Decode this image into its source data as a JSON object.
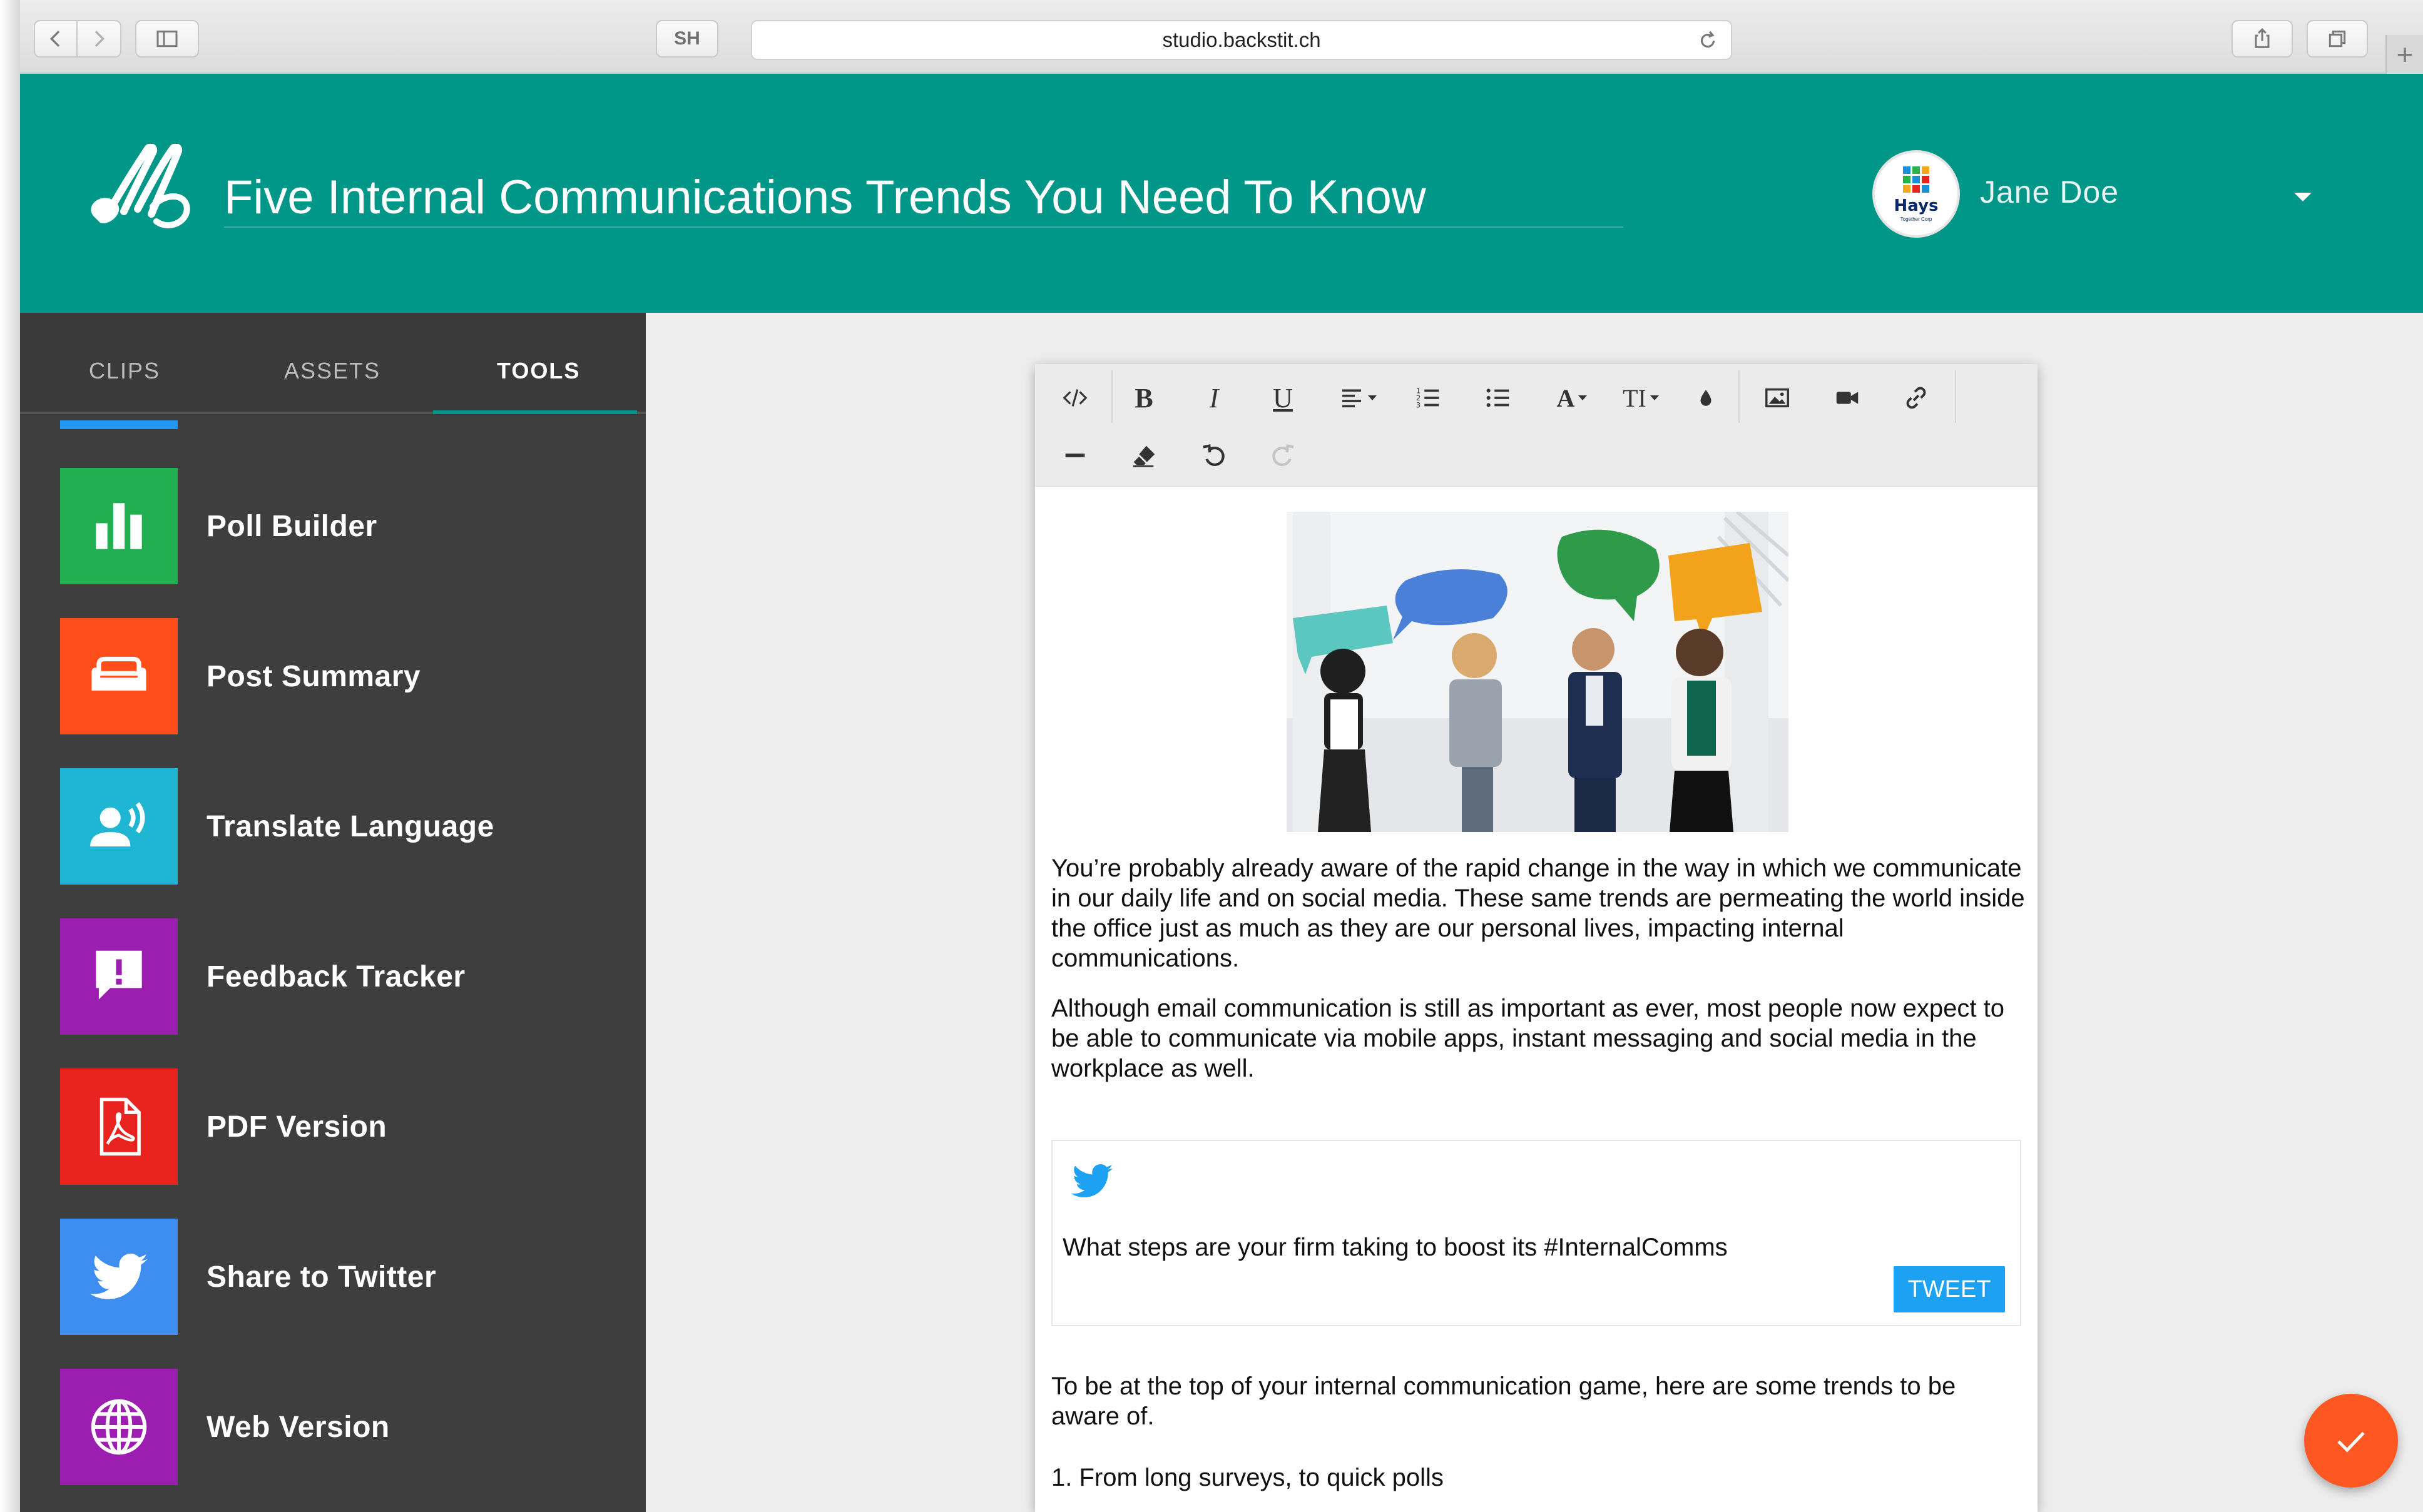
{
  "browser": {
    "url": "studio.backstit.ch",
    "sh_label": "SH",
    "new_tab": "+"
  },
  "header": {
    "title": "Five Internal Communications Trends You Need To Know",
    "user_name": "Jane Doe",
    "avatar_brand": "Hays",
    "avatar_tagline": "Together Corp",
    "brand_color": "#009688"
  },
  "sidebar": {
    "tabs": [
      {
        "label": "CLIPS",
        "active": false
      },
      {
        "label": "ASSETS",
        "active": false
      },
      {
        "label": "TOOLS",
        "active": true
      }
    ],
    "tools": [
      {
        "label": "Poll Builder",
        "icon": "bar-chart-icon",
        "color": "#20b052"
      },
      {
        "label": "Post Summary",
        "icon": "sofa-icon",
        "color": "#ff4e1a"
      },
      {
        "label": "Translate Language",
        "icon": "speaker-person-icon",
        "color": "#1fb6d4"
      },
      {
        "label": "Feedback Tracker",
        "icon": "feedback-icon",
        "color": "#9c1eb0"
      },
      {
        "label": "PDF Version",
        "icon": "pdf-icon",
        "color": "#e8231f"
      },
      {
        "label": "Share to Twitter",
        "icon": "twitter-icon",
        "color": "#3d8ef0"
      },
      {
        "label": "Web Version",
        "icon": "globe-icon",
        "color": "#9c1eb0"
      }
    ]
  },
  "toolbar": {
    "bold": "B",
    "italic": "I",
    "underline": "U",
    "font": "A",
    "size": "TI"
  },
  "editor": {
    "paragraph1": "You’re probably already aware of the rapid change in the way in which we communicate in our daily life and on social media. These same trends are permeating the world inside the office just as much as they are our personal lives, impacting internal communications.",
    "paragraph2": "Although email communication is still as important as ever, most people now expect to be able to communicate via mobile apps, instant messaging and social media in the workplace as well.",
    "tweet_text": "What steps are your firm taking to boost its #InternalComms",
    "tweet_button": "TWEET",
    "paragraph3": "To be at the top of your internal communication game, here are some trends to be aware of.",
    "list_item1": "1. From long surveys, to quick polls"
  },
  "accent_colors": {
    "tab_underline": "#009688",
    "fab": "#ff5722",
    "tweet": "#1da1f2"
  }
}
